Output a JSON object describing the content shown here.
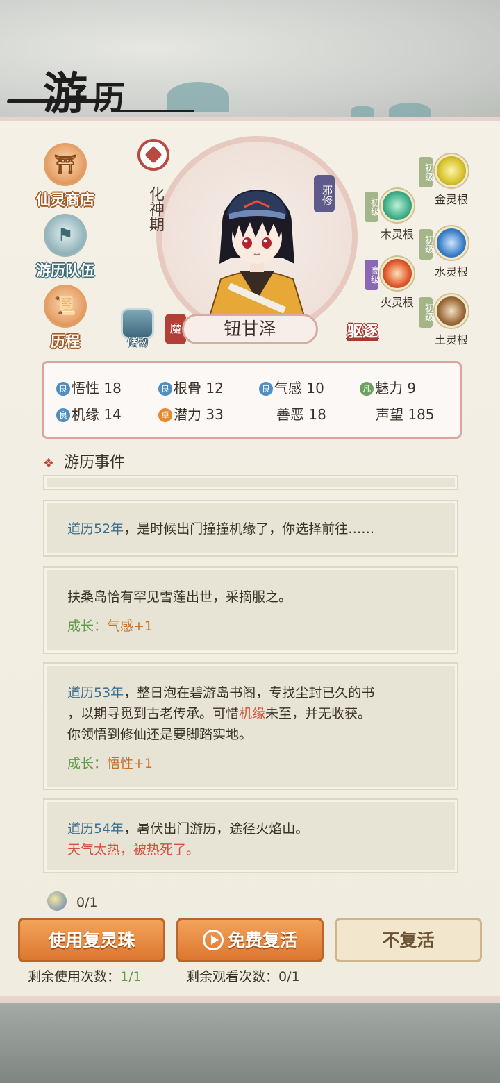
{
  "header": {
    "title_main": "游",
    "title_second": "历"
  },
  "side_menu": [
    {
      "label": "仙灵商店",
      "icon": "shop-icon"
    },
    {
      "label": "游历队伍",
      "icon": "team-flag-icon"
    },
    {
      "label": "历程",
      "icon": "scroll-icon"
    }
  ],
  "character": {
    "realm": "化神期",
    "sect_tag": "邪修",
    "demon_badge": "魔",
    "name": "钮甘泽",
    "storage_label": "储物",
    "expel_label": "驱逐"
  },
  "spirit_roots": [
    {
      "level": "初级",
      "name": "金灵根",
      "color": "#d6c12b"
    },
    {
      "level": "初级",
      "name": "木灵根",
      "color": "#3fae8a"
    },
    {
      "level": "初级",
      "name": "水灵根",
      "color": "#3b7ec6"
    },
    {
      "level": "高级",
      "name": "火灵根",
      "color": "#e0562a"
    },
    {
      "level": "初级",
      "name": "土灵根",
      "color": "#9a6a3a"
    }
  ],
  "stats": {
    "wuxing": {
      "tag": "良",
      "label": "悟性",
      "value": "18"
    },
    "gengu": {
      "tag": "良",
      "label": "根骨",
      "value": "12"
    },
    "qigan": {
      "tag": "良",
      "label": "气感",
      "value": "10"
    },
    "meili": {
      "tag": "凡",
      "label": "魅力",
      "value": "9"
    },
    "jiyuan": {
      "tag": "良",
      "label": "机缘",
      "value": "14"
    },
    "qianli": {
      "tag": "卓",
      "label": "潜力",
      "value": "33"
    },
    "shane": {
      "label": "善恶",
      "value": "18"
    },
    "shengwang": {
      "label": "声望",
      "value": "185"
    }
  },
  "events_title": "游历事件",
  "events": {
    "e1": {
      "year": "道历52年",
      "text": "，是时候出门撞撞机缘了，你选择前往……"
    },
    "e2": {
      "text": "扶桑岛恰有罕见雪莲出世，采摘服之。",
      "growth_label": "成长：",
      "growth_value": "气感+1"
    },
    "e3": {
      "year": "道历53年",
      "text_a": "，整日泡在碧游岛书阁，专找尘封已久的书",
      "text_b": "，以期寻觅到古老传承。可惜",
      "highlight": "机缘",
      "text_c": "未至，并无收获。",
      "text_d": "你领悟到修仙还是要脚踏实地。",
      "growth_label": "成长：",
      "growth_value": "悟性+1"
    },
    "e4": {
      "year": "道历54年",
      "text": "，暑伏出门游历，途径火焰山。",
      "death": "天气太热，被热死了。"
    }
  },
  "revive": {
    "count": "0/1",
    "use_pearl": "使用复灵珠",
    "free_revive": "免费复活",
    "no_revive": "不复活",
    "remain_use_label": "剩余使用次数：",
    "remain_use_value": "1/1",
    "remain_watch_label": "剩余观看次数：",
    "remain_watch_value": "0/1"
  }
}
